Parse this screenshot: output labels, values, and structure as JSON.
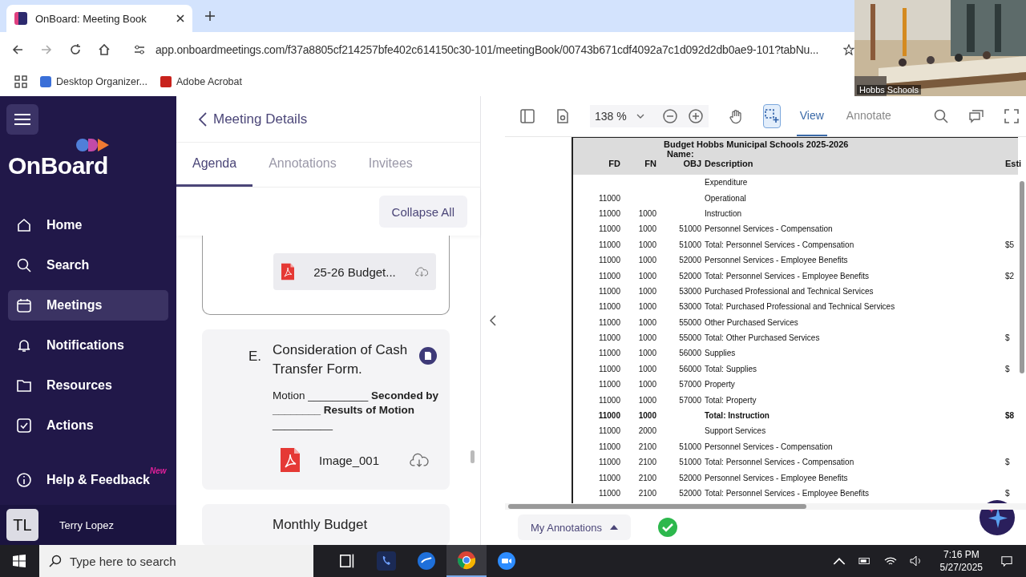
{
  "browser": {
    "tab_title": "OnBoard: Meeting Book",
    "url": "app.onboardmeetings.com/f37a8805cf214257bfe402c614150c30-101/meetingBook/00743b671cdf4092a7c1d092d2db0ae9-101?tabNu...",
    "bookmarks": [
      "Desktop Organizer...",
      "Adobe Acrobat"
    ]
  },
  "video_inset": {
    "caption": "Hobbs Schools"
  },
  "sidebar": {
    "logo": "OnBoard",
    "items": [
      {
        "label": "Home",
        "selected": false
      },
      {
        "label": "Search",
        "selected": false
      },
      {
        "label": "Meetings",
        "selected": true
      },
      {
        "label": "Notifications",
        "selected": false
      },
      {
        "label": "Resources",
        "selected": false
      },
      {
        "label": "Actions",
        "selected": false
      }
    ],
    "help": {
      "label": "Help & Feedback",
      "badge": "New"
    },
    "user": {
      "initials": "TL",
      "name": "Terry Lopez"
    }
  },
  "meeting": {
    "back_label": "Meeting Details",
    "tabs": [
      {
        "label": "Agenda",
        "selected": true
      },
      {
        "label": "Annotations",
        "selected": false
      },
      {
        "label": "Invitees",
        "selected": false
      }
    ],
    "collapse_button": "Collapse All",
    "items": [
      {
        "attachments": [
          {
            "name": "25-26 Budget..."
          }
        ]
      },
      {
        "letter": "E.",
        "title": "Consideration of Cash Transfer Form.",
        "motion": "Motion __________ **Seconded by ________ Results of Motion** __________",
        "attachments": [
          {
            "name": "Image_001"
          }
        ]
      },
      {
        "title": "Monthly Budget"
      }
    ]
  },
  "pdf": {
    "zoom": "138 %",
    "modes": [
      {
        "label": "View",
        "selected": true
      },
      {
        "label": "Annotate",
        "selected": false
      }
    ],
    "document": {
      "title": "Budget Hobbs Municipal Schools 2025-2026",
      "name_label": "Name:",
      "columns": [
        "FD",
        "FN",
        "OBJ",
        "Description",
        "Esti"
      ],
      "rows": [
        {
          "description": "Expenditure",
          "bold": false
        },
        {
          "fd": "11000",
          "description": "Operational",
          "bold": false
        },
        {
          "fd": "11000",
          "fn": "1000",
          "description": "Instruction",
          "bold": false
        },
        {
          "fd": "11000",
          "fn": "1000",
          "obj": "51000",
          "description": "Personnel Services - Compensation",
          "bold": false
        },
        {
          "fd": "11000",
          "fn": "1000",
          "obj": "51000",
          "description": "Total: Personnel Services - Compensation",
          "estimate": "$5",
          "bold": false
        },
        {
          "fd": "11000",
          "fn": "1000",
          "obj": "52000",
          "description": "Personnel Services - Employee Benefits",
          "bold": false
        },
        {
          "fd": "11000",
          "fn": "1000",
          "obj": "52000",
          "description": "Total: Personnel Services - Employee Benefits",
          "estimate": "$2",
          "bold": false
        },
        {
          "fd": "11000",
          "fn": "1000",
          "obj": "53000",
          "description": "Purchased Professional and Technical Services",
          "bold": false
        },
        {
          "fd": "11000",
          "fn": "1000",
          "obj": "53000",
          "description": "Total: Purchased Professional and Technical Services",
          "bold": false
        },
        {
          "fd": "11000",
          "fn": "1000",
          "obj": "55000",
          "description": "Other Purchased Services",
          "bold": false
        },
        {
          "fd": "11000",
          "fn": "1000",
          "obj": "55000",
          "description": "Total: Other Purchased Services",
          "estimate": "$",
          "bold": false
        },
        {
          "fd": "11000",
          "fn": "1000",
          "obj": "56000",
          "description": "Supplies",
          "bold": false
        },
        {
          "fd": "11000",
          "fn": "1000",
          "obj": "56000",
          "description": "Total: Supplies",
          "estimate": "$",
          "bold": false
        },
        {
          "fd": "11000",
          "fn": "1000",
          "obj": "57000",
          "description": "Property",
          "bold": false
        },
        {
          "fd": "11000",
          "fn": "1000",
          "obj": "57000",
          "description": "Total: Property",
          "bold": false
        },
        {
          "fd": "11000",
          "fn": "1000",
          "description": "Total: Instruction",
          "estimate": "$8",
          "bold": true
        },
        {
          "fd": "11000",
          "fn": "2000",
          "description": "Support Services",
          "bold": false
        },
        {
          "fd": "11000",
          "fn": "2100",
          "obj": "51000",
          "description": "Personnel Services - Compensation",
          "bold": false
        },
        {
          "fd": "11000",
          "fn": "2100",
          "obj": "51000",
          "description": "Total: Personnel Services - Compensation",
          "estimate": "$",
          "bold": false
        },
        {
          "fd": "11000",
          "fn": "2100",
          "obj": "52000",
          "description": "Personnel Services - Employee Benefits",
          "bold": false
        },
        {
          "fd": "11000",
          "fn": "2100",
          "obj": "52000",
          "description": "Total: Personnel Services - Employee Benefits",
          "estimate": "$",
          "bold": false
        }
      ]
    },
    "annotations_button": "My Annotations"
  },
  "taskbar": {
    "search_placeholder": "Type here to search",
    "time": "7:16 PM",
    "date": "5/27/2025"
  }
}
